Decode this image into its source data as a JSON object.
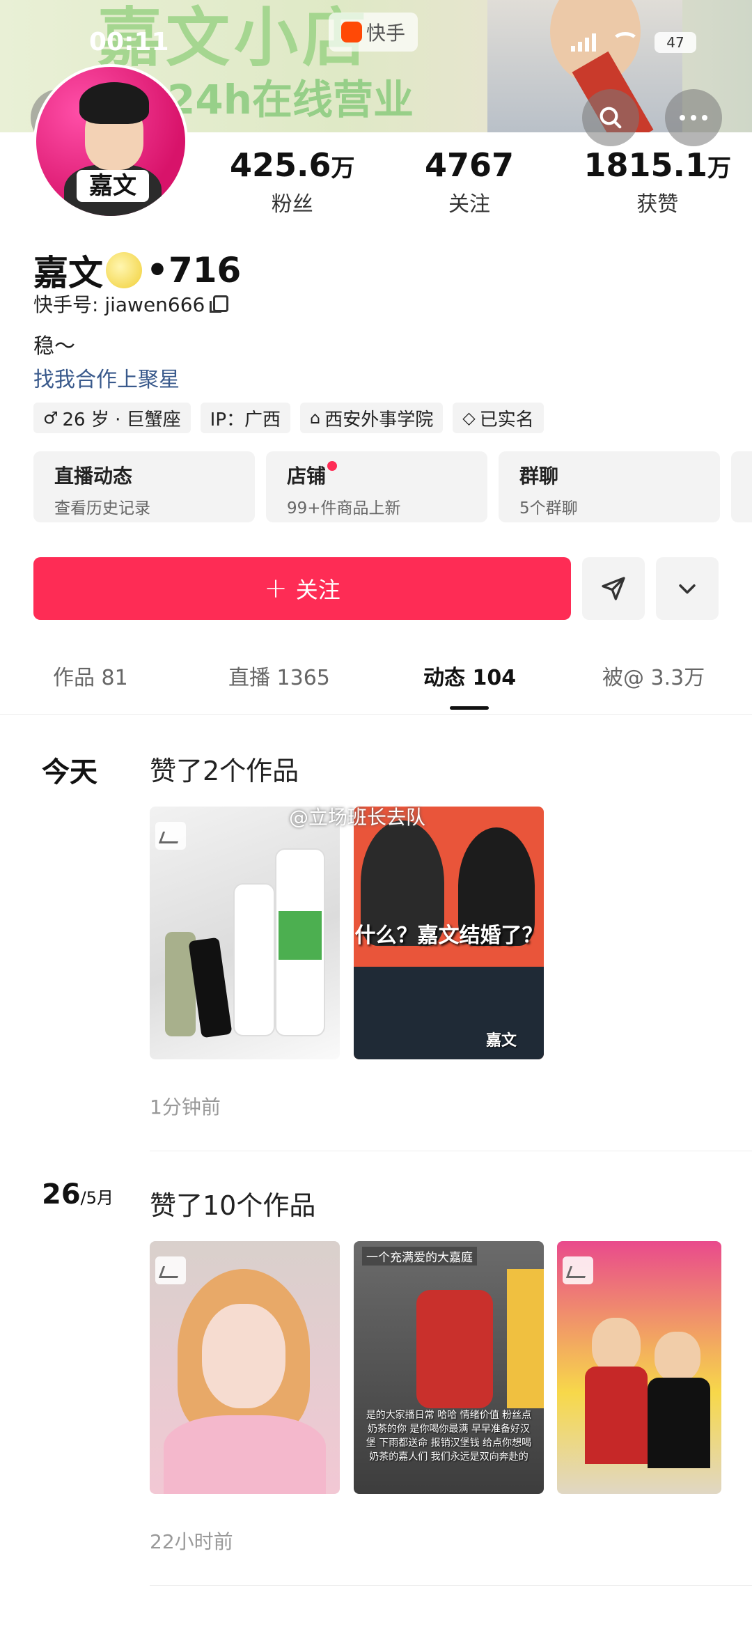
{
  "status_bar": {
    "time": "00:11",
    "battery": "47"
  },
  "banner": {
    "title_text": "嘉文小店",
    "subtitle_text": "24h在线营业",
    "platform_label": "快手"
  },
  "profile": {
    "avatar_text": "嘉文",
    "name": "嘉文",
    "name_suffix": "•716",
    "uid_label": "快手号: jiawen666",
    "bio": "稳～",
    "biz_link": "找我合作上聚星"
  },
  "stats": [
    {
      "value": "425.6",
      "unit": "万",
      "label": "粉丝"
    },
    {
      "value": "4767",
      "unit": "",
      "label": "关注"
    },
    {
      "value": "1815.1",
      "unit": "万",
      "label": "获赞"
    }
  ],
  "chips": [
    {
      "icon": "♂",
      "text": "26 岁 · 巨蟹座"
    },
    {
      "icon": "",
      "text": "IP：广西"
    },
    {
      "icon": "⌂",
      "text": "西安外事学院"
    },
    {
      "icon": "◇",
      "text": "已实名"
    }
  ],
  "cards": [
    {
      "title": "直播动态",
      "subtitle": "查看历史记录"
    },
    {
      "title": "店铺",
      "subtitle": "99+件商品上新"
    },
    {
      "title": "群聊",
      "subtitle": "5个群聊"
    }
  ],
  "actions": {
    "follow_label": "关注"
  },
  "tabs": [
    {
      "label": "作品 81"
    },
    {
      "label": "直播 1365"
    },
    {
      "label": "动态 104"
    },
    {
      "label": "被@ 3.3万"
    }
  ],
  "feed": [
    {
      "date": "今天",
      "title": "赞了2个作品",
      "time_ago": "1分钟前",
      "watermark": "@立场班长去队",
      "thumbs": [
        {
          "caption": ""
        },
        {
          "caption": "什么？嘉文结婚了？",
          "tag": "嘉文"
        }
      ]
    },
    {
      "date_day": "26",
      "date_month": "/5月",
      "title": "赞了10个作品",
      "time_ago": "22小时前",
      "thumbs": [
        {
          "caption": ""
        },
        {
          "caption": "一个充满爱的大嘉庭",
          "overlay_text": "是的大家播日常 哈哈 情绪价值 粉丝点奶茶的你 是你喝你最满 早早准备好汉堡 下雨都送命 报销汉堡钱 给点你想喝奶茶的嘉人们 我们永远是双向奔赴的"
        },
        {
          "caption": ""
        }
      ]
    }
  ],
  "colors": {
    "accent": "#fe2c55",
    "link": "#3a5a8c"
  }
}
